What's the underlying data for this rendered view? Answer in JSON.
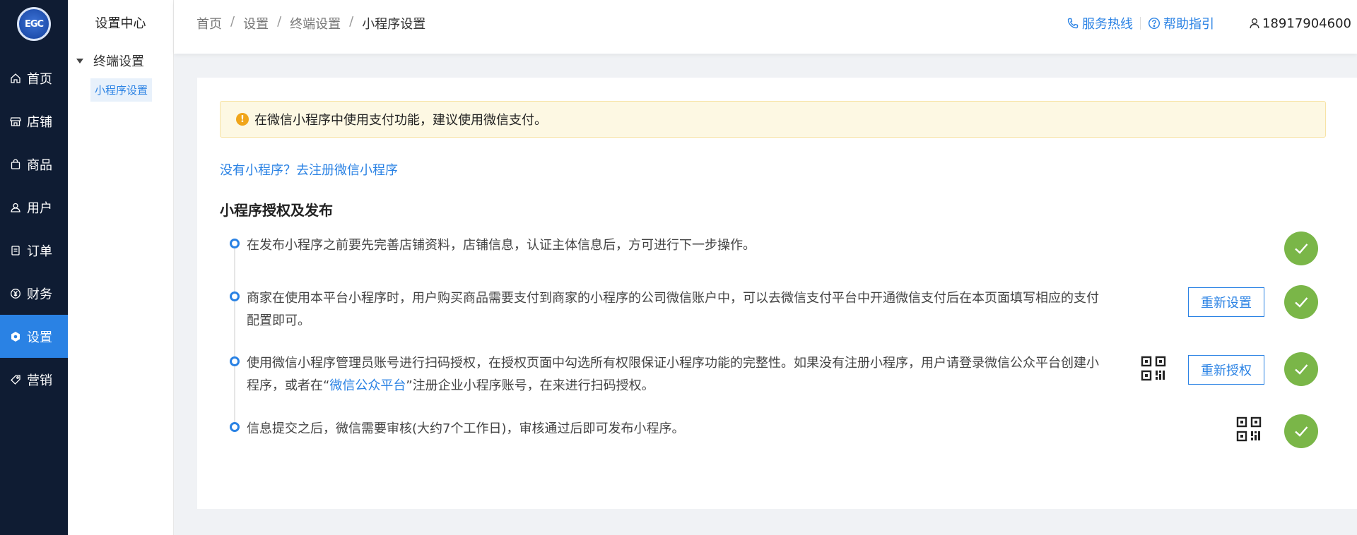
{
  "nav": {
    "logo_text": "EGC",
    "items": [
      {
        "label": "首页",
        "icon": "home-icon",
        "active": false
      },
      {
        "label": "店铺",
        "icon": "store-icon",
        "active": false
      },
      {
        "label": "商品",
        "icon": "goods-icon",
        "active": false
      },
      {
        "label": "用户",
        "icon": "user-icon",
        "active": false
      },
      {
        "label": "订单",
        "icon": "order-icon",
        "active": false
      },
      {
        "label": "财务",
        "icon": "finance-icon",
        "active": false
      },
      {
        "label": "设置",
        "icon": "settings-icon",
        "active": true
      },
      {
        "label": "营销",
        "icon": "tag-icon",
        "active": false
      }
    ]
  },
  "subnav": {
    "title": "设置中心",
    "group": "终端设置",
    "item": "小程序设置"
  },
  "header": {
    "breadcrumb": [
      "首页",
      "设置",
      "终端设置",
      "小程序设置"
    ],
    "separator": "/",
    "hotline": "服务热线",
    "help": "帮助指引",
    "user": "18917904600"
  },
  "main": {
    "alert": "在微信小程序中使用支付功能，建议使用微信支付。",
    "alert_icon_text": "!",
    "register_link": "没有小程序？去注册微信小程序",
    "section_title": "小程序授权及发布",
    "steps": [
      {
        "text": "在发布小程序之前要先完善店铺资料，店铺信息，认证主体信息后，方可进行下一步操作。"
      },
      {
        "text": "商家在使用本平台小程序时，用户购买商品需要支付到商家的小程序的公司微信账户中，可以去微信支付平台中开通微信支付后在本页面填写相应的支付配置即可。",
        "button": "重新设置"
      },
      {
        "text_before": "使用微信小程序管理员账号进行扫码授权，在授权页面中勾选所有权限保证小程序功能的完整性。如果没有注册小程序，用户请登录微信公众平台创建小程序，或者在“",
        "link": "微信公众平台",
        "text_after": "”注册企业小程序账号，在来进行扫码授权。",
        "button": "重新授权"
      },
      {
        "text": "信息提交之后，微信需要审核(大约7个工作日)，审核通过后即可发布小程序。"
      }
    ]
  },
  "colors": {
    "nav_bg": "#0f1c33",
    "accent": "#2a82e4",
    "success": "#7ab648",
    "warning": "#f0a51a"
  }
}
